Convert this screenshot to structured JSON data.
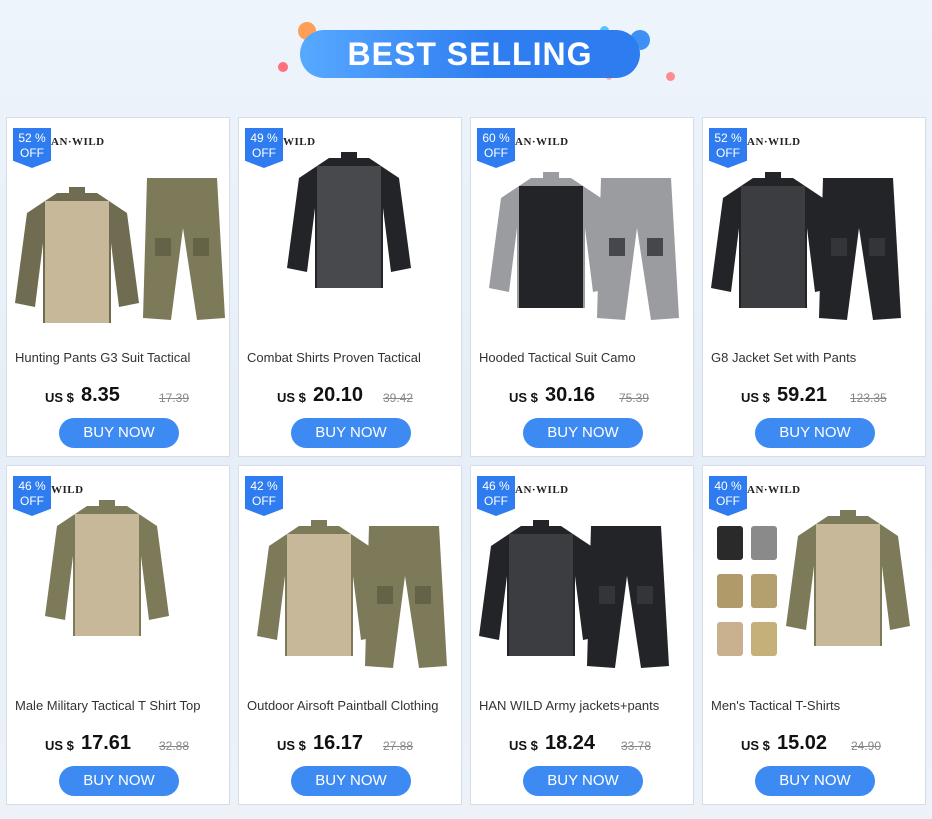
{
  "header": {
    "title": "BEST SELLING"
  },
  "colors": {
    "accent": "#2e7cf0",
    "button": "#3d8bf2"
  },
  "products": [
    {
      "discount_pct": "52 %",
      "discount_off": "OFF",
      "brand": "AN·WILD",
      "title": "Hunting Pants G3 Suit Tactical",
      "currency": "US $",
      "price": "8.35",
      "original_price": "17.39",
      "button": "BUY NOW"
    },
    {
      "discount_pct": "49 %",
      "discount_off": "OFF",
      "brand": "WILD",
      "title": "Combat Shirts Proven Tactical",
      "currency": "US $",
      "price": "20.10",
      "original_price": "39.42",
      "button": "BUY NOW"
    },
    {
      "discount_pct": "60 %",
      "discount_off": "OFF",
      "brand": "AN·WILD",
      "title": "Hooded Tactical Suit Camo",
      "currency": "US $",
      "price": "30.16",
      "original_price": "75.39",
      "button": "BUY NOW"
    },
    {
      "discount_pct": "52 %",
      "discount_off": "OFF",
      "brand": "AN·WILD",
      "title": "G8 Jacket Set with Pants",
      "currency": "US $",
      "price": "59.21",
      "original_price": "123.35",
      "button": "BUY NOW"
    },
    {
      "discount_pct": "46 %",
      "discount_off": "OFF",
      "brand": "WILD",
      "title": "Male Military Tactical T Shirt Top",
      "currency": "US $",
      "price": "17.61",
      "original_price": "32.88",
      "button": "BUY NOW"
    },
    {
      "discount_pct": "42 %",
      "discount_off": "OFF",
      "brand": "",
      "title": "Outdoor Airsoft Paintball Clothing",
      "currency": "US $",
      "price": "16.17",
      "original_price": "27.88",
      "button": "BUY NOW"
    },
    {
      "discount_pct": "46 %",
      "discount_off": "OFF",
      "brand": "AN·WILD",
      "title": "HAN WILD Army jackets+pants",
      "currency": "US $",
      "price": "18.24",
      "original_price": "33.78",
      "button": "BUY NOW"
    },
    {
      "discount_pct": "40 %",
      "discount_off": "OFF",
      "brand": "AN·WILD",
      "title": "Men's Tactical T-Shirts",
      "currency": "US $",
      "price": "15.02",
      "original_price": "24.90",
      "button": "BUY NOW"
    }
  ]
}
